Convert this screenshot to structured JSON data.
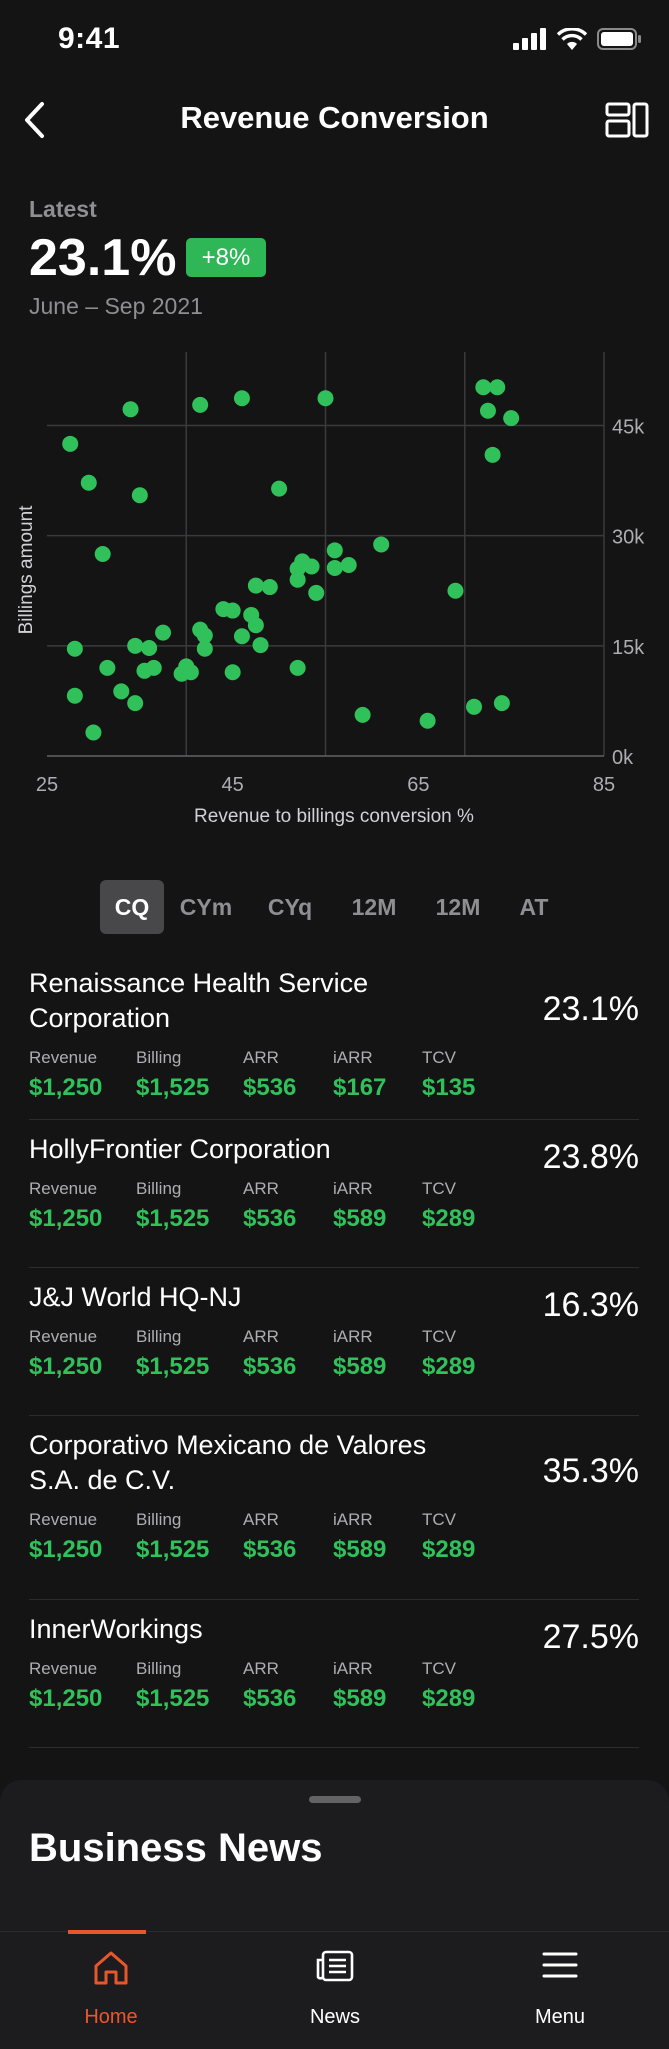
{
  "status": {
    "time": "9:41"
  },
  "nav": {
    "title": "Revenue Conversion"
  },
  "summary": {
    "latest_label": "Latest",
    "value": "23.1%",
    "change": "+8%",
    "date_range": "June – Sep 2021"
  },
  "colors": {
    "accent_green": "#30c15a",
    "active_tab": "#e8572c",
    "background": "#141415"
  },
  "chart_data": {
    "type": "scatter",
    "xlabel": "Revenue to billings conversion %",
    "ylabel": "Billings amount",
    "xlim": [
      25,
      85
    ],
    "ylim": [
      0,
      55000
    ],
    "x_ticks": [
      "25",
      "45",
      "65",
      "85"
    ],
    "y_ticks": [
      "0k",
      "15k",
      "30k",
      "45k"
    ],
    "y_tick_values": [
      0,
      15000,
      30000,
      45000
    ],
    "grid": true,
    "points": [
      [
        27.5,
        42500
      ],
      [
        28,
        14600
      ],
      [
        28,
        8200
      ],
      [
        29.5,
        37200
      ],
      [
        30,
        3200
      ],
      [
        31,
        27500
      ],
      [
        31.5,
        12000
      ],
      [
        33,
        8800
      ],
      [
        34,
        47200
      ],
      [
        34.5,
        7200
      ],
      [
        34.5,
        15000
      ],
      [
        35,
        35500
      ],
      [
        35.5,
        11600
      ],
      [
        36,
        14700
      ],
      [
        36.5,
        12000
      ],
      [
        37.5,
        16800
      ],
      [
        39.5,
        11200
      ],
      [
        40,
        12200
      ],
      [
        40.5,
        11400
      ],
      [
        41.5,
        47800
      ],
      [
        41.5,
        17200
      ],
      [
        42,
        14600
      ],
      [
        42,
        16400
      ],
      [
        44,
        20000
      ],
      [
        45,
        19800
      ],
      [
        45,
        11400
      ],
      [
        46,
        48700
      ],
      [
        46,
        16300
      ],
      [
        47,
        19200
      ],
      [
        47.5,
        23200
      ],
      [
        47.5,
        17800
      ],
      [
        48,
        15100
      ],
      [
        49,
        23000
      ],
      [
        50,
        36400
      ],
      [
        52,
        12000
      ],
      [
        52,
        25500
      ],
      [
        52,
        24000
      ],
      [
        52.5,
        26500
      ],
      [
        53.5,
        25800
      ],
      [
        54,
        22200
      ],
      [
        55,
        48700
      ],
      [
        56,
        28000
      ],
      [
        56,
        25600
      ],
      [
        57.5,
        26000
      ],
      [
        59,
        5600
      ],
      [
        61,
        28800
      ],
      [
        66,
        4800
      ],
      [
        69,
        22500
      ],
      [
        71,
        6700
      ],
      [
        72,
        50200
      ],
      [
        72.5,
        47000
      ],
      [
        73,
        41000
      ],
      [
        73.5,
        50200
      ],
      [
        74,
        7200
      ],
      [
        75,
        46000
      ]
    ]
  },
  "period_tabs": [
    "CQ",
    "CYm",
    "CYq",
    "12M",
    "12M",
    "AT"
  ],
  "metric_labels": [
    "Revenue",
    "Billing",
    "ARR",
    "iARR",
    "TCV"
  ],
  "accounts": [
    {
      "name": "Renaissance Health Service Corporation",
      "pct": "23.1%",
      "values": [
        "$1,250",
        "$1,525",
        "$536",
        "$167",
        "$135"
      ]
    },
    {
      "name": "HollyFrontier Corporation",
      "pct": "23.8%",
      "values": [
        "$1,250",
        "$1,525",
        "$536",
        "$589",
        "$289"
      ]
    },
    {
      "name": "J&J World HQ-NJ",
      "pct": "16.3%",
      "values": [
        "$1,250",
        "$1,525",
        "$536",
        "$589",
        "$289"
      ]
    },
    {
      "name": "Corporativo Mexicano de Valores S.A. de C.V.",
      "pct": "35.3%",
      "values": [
        "$1,250",
        "$1,525",
        "$536",
        "$589",
        "$289"
      ]
    },
    {
      "name": "InnerWorkings",
      "pct": "27.5%",
      "values": [
        "$1,250",
        "$1,525",
        "$536",
        "$589",
        "$289"
      ]
    }
  ],
  "sheet": {
    "title": "Business News"
  },
  "tabbar": [
    {
      "label": "Home",
      "icon": "home-icon",
      "active": true
    },
    {
      "label": "News",
      "icon": "news-icon",
      "active": false
    },
    {
      "label": "Menu",
      "icon": "menu-icon",
      "active": false
    }
  ]
}
